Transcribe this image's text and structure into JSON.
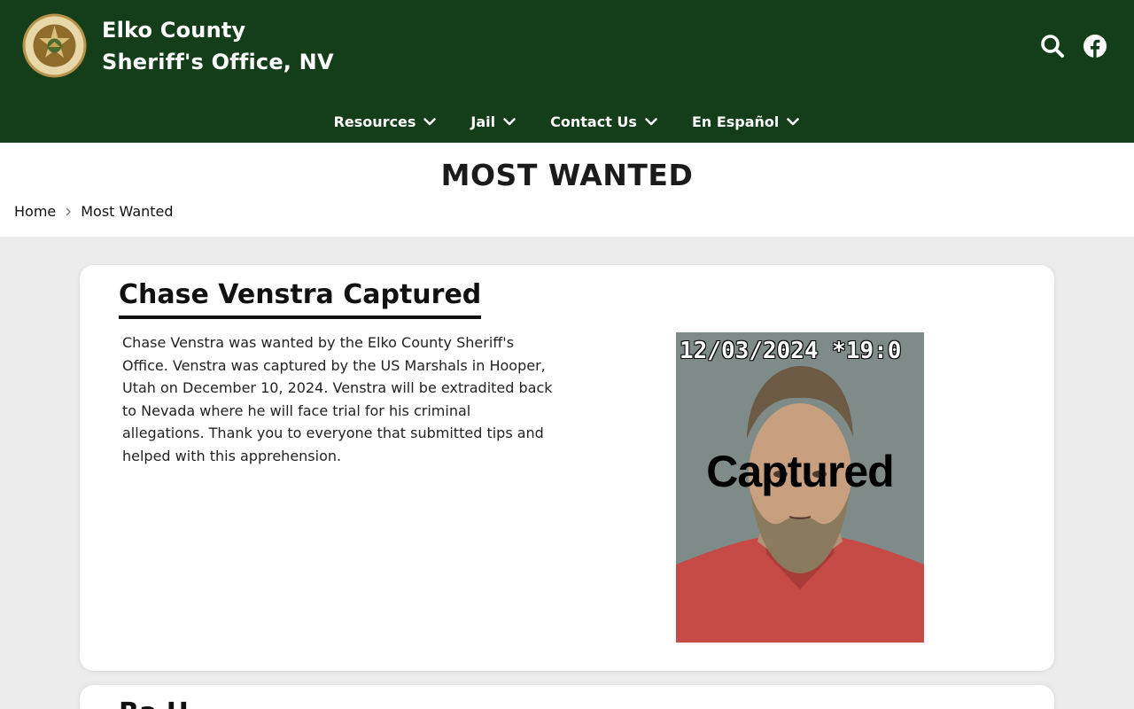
{
  "colors": {
    "header_bg": "#143d1a",
    "page_bg": "#ebebeb",
    "card_bg": "#ffffff"
  },
  "header": {
    "title_line1": "Elko County",
    "title_line2": "Sheriff's Office, NV",
    "logo_icon": "sheriff-badge-icon",
    "search_icon": "search-icon",
    "social_icon": "facebook-icon"
  },
  "nav": {
    "items": [
      {
        "label": "Resources"
      },
      {
        "label": "Jail"
      },
      {
        "label": "Contact Us"
      },
      {
        "label": "En Español"
      }
    ]
  },
  "page": {
    "title": "MOST WANTED",
    "breadcrumb": {
      "home": "Home",
      "current": "Most Wanted"
    }
  },
  "article": {
    "title": "Chase Venstra Captured",
    "body": "Chase Venstra was wanted by the Elko County Sheriff's Office.  Venstra was captured by the US Marshals in Hooper, Utah on December 10, 2024.  Venstra will be extradited back to Nevada where he will face trial for his criminal allegations.  Thank you to everyone that submitted tips and helped with this apprehension.",
    "photo_timestamp": "12/03/2024 *19:0",
    "photo_stamp": "Captured"
  },
  "next_article": {
    "title": "Ra H"
  }
}
